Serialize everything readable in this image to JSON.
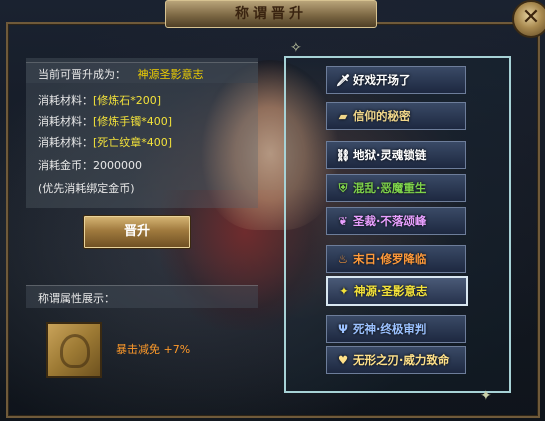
{
  "window": {
    "title": "称谓晋升",
    "close_icon": "close-icon"
  },
  "upgrade": {
    "label": "当前可晋升成为：",
    "target": "神源圣影意志"
  },
  "materials": [
    {
      "label": "消耗材料：",
      "value": "[修炼石*200]"
    },
    {
      "label": "消耗材料：",
      "value": "[修炼手镯*400]"
    },
    {
      "label": "消耗材料：",
      "value": "[死亡纹章*400]"
    }
  ],
  "gold": {
    "label": "消耗金币：",
    "value": "2000000"
  },
  "gold_note": "(优先消耗绑定金币)",
  "promote_button": "晋升",
  "attributes": {
    "header": "称谓属性展示：",
    "effect": "暴击减免 +7%"
  },
  "title_list": [
    {
      "label": "好戏开场了",
      "icon": "sword-icon",
      "color": "#ffffff"
    },
    {
      "label": "信仰的秘密",
      "icon": "scroll-icon",
      "color": "#f0d68a"
    },
    {
      "label": "地狱·灵魂锁链",
      "icon": "chain-icon",
      "color": "#ffffff"
    },
    {
      "label": "混乱·恶魔重生",
      "icon": "shield-icon",
      "color": "#7ed24a"
    },
    {
      "label": "圣裁·不落颂峰",
      "icon": "wing-icon",
      "color": "#e8a0ff"
    },
    {
      "label": "末日·修罗降临",
      "icon": "flame-icon",
      "color": "#ff9a3a"
    },
    {
      "label": "神源·圣影意志",
      "icon": "star-icon",
      "color": "#f3e23a",
      "selected": true
    },
    {
      "label": "死神·终极审判",
      "icon": "scythe-icon",
      "color": "#9cc2ff"
    },
    {
      "label": "无形之刃·威力致命",
      "icon": "heart-icon",
      "color": "#ffe18a"
    }
  ]
}
